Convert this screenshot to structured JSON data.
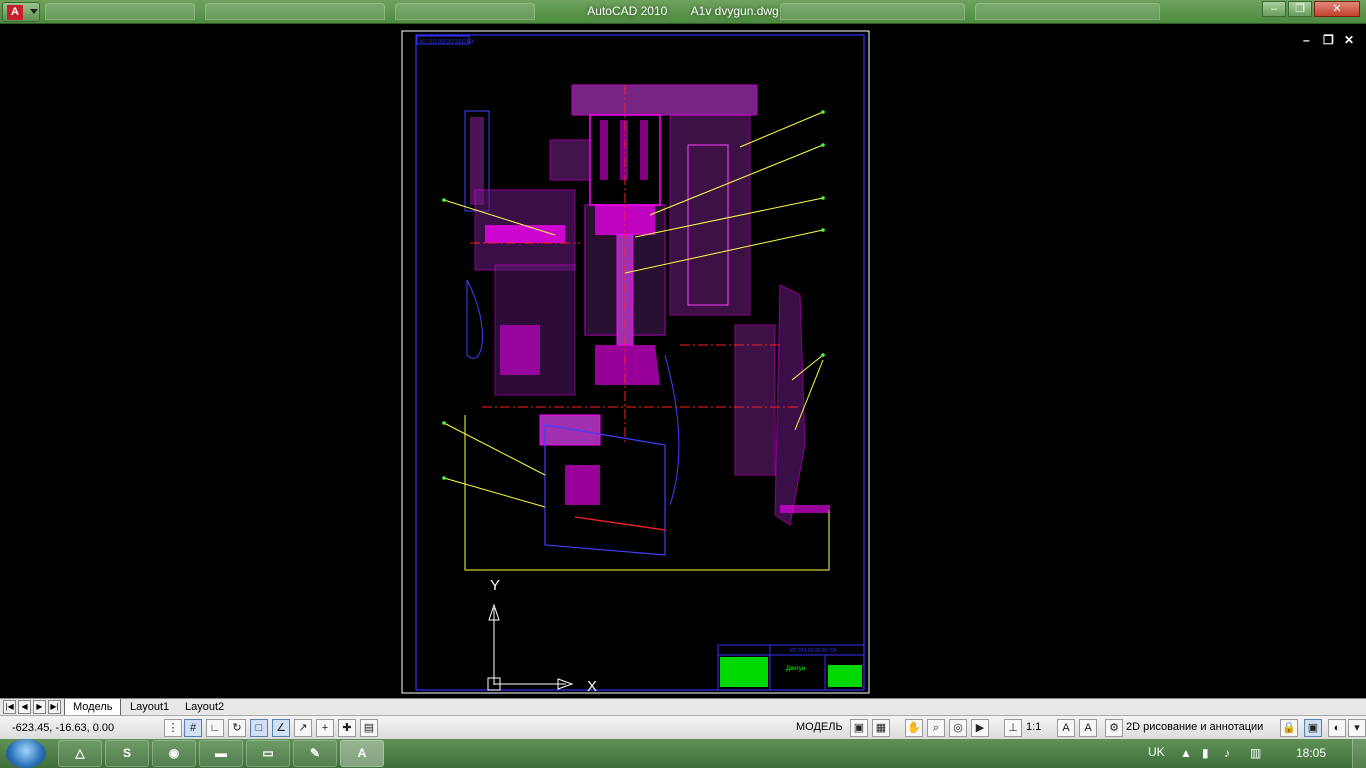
{
  "window": {
    "app_name": "AutoCAD 2010",
    "file_name": "A1v dvygun.dwg",
    "minimize": "–",
    "maximize": "❐",
    "close": "✕",
    "app_logo": "A"
  },
  "document_controls": {
    "minimize": "–",
    "restore": "❐",
    "close": "✕"
  },
  "drawing": {
    "frame_label": "ХО ’ОО’ОО’ОО’ББО ЦХ",
    "title_block_code": "КП 039.00.00.00. СК",
    "title_block_name": "Двигун",
    "ucs_y": "Y",
    "ucs_x": "X",
    "colors": {
      "magenta": "#ff00ff",
      "purple_hatch": "#c040c0",
      "blue_frame": "#3030ff",
      "yellow": "#ffff40",
      "red": "#ff2020",
      "green": "#00ff00",
      "white": "#ffffff"
    }
  },
  "layout_tabs": {
    "items": [
      "Модель",
      "Layout1",
      "Layout2"
    ],
    "active": "Модель"
  },
  "status_bar": {
    "coordinates": "-623.45, -16.63, 0.00",
    "model_label": "МОДЕЛЬ",
    "annotation_scale": "1:1",
    "workspace": "2D рисование и аннотации"
  },
  "taskbar": {
    "apps": [
      "autodesk-icon",
      "skype-icon",
      "chrome-icon",
      "terminal-icon",
      "folder-icon",
      "paint-icon",
      "autocad-icon"
    ],
    "active_app": "autocad-icon",
    "language": "UK",
    "clock": "18:05"
  }
}
